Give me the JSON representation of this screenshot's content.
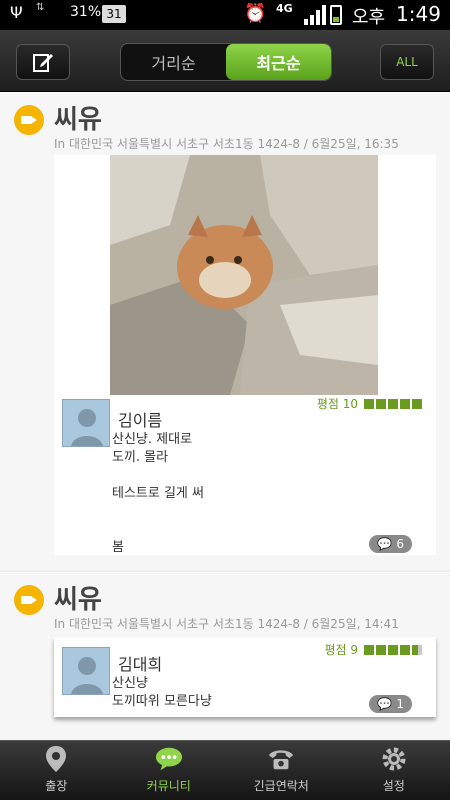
{
  "status_bar": {
    "battery_percent": "31%",
    "calendar_day": "31",
    "network": "4G",
    "ampm": "오후",
    "time": "1:49"
  },
  "toolbar": {
    "tabs": [
      {
        "label": "거리순",
        "active": false
      },
      {
        "label": "최근순",
        "active": true
      }
    ],
    "all_label": "ALL"
  },
  "posts": [
    {
      "title": "씨유",
      "meta": "In 대한민국 서울특별시 서초구 서초1동 1424-8 / 6월25일, 16:35",
      "has_photo": true,
      "review": {
        "name": "김이름",
        "rating_label": "평점 10",
        "rating_fraction": 1.0,
        "comment": "산신냥. 제대로\n도끼. 몰라\n\n테스트로 길게 써\n\n\n봄",
        "comment_count": "6"
      }
    },
    {
      "title": "씨유",
      "meta": "In 대한민국 서울특별시 서초구 서초1동 1424-8 / 6월25일, 14:41",
      "has_photo": false,
      "review": {
        "name": "김대희",
        "rating_label": "평점 9",
        "rating_fraction": 0.9,
        "comment": "산신냥\n도끼따위 모른다냥",
        "comment_count": "1"
      }
    }
  ],
  "bottom_nav": [
    {
      "label": "출장",
      "icon": "map-pin-icon",
      "active": false
    },
    {
      "label": "커뮤니티",
      "icon": "chat-bubble-icon",
      "active": true
    },
    {
      "label": "긴급연락처",
      "icon": "phone-icon",
      "active": false
    },
    {
      "label": "설정",
      "icon": "gear-icon",
      "active": false
    }
  ],
  "colors": {
    "accent_green": "#8fd44b",
    "rating_green": "#6a9a1f",
    "pin_yellow": "#f5b400"
  }
}
